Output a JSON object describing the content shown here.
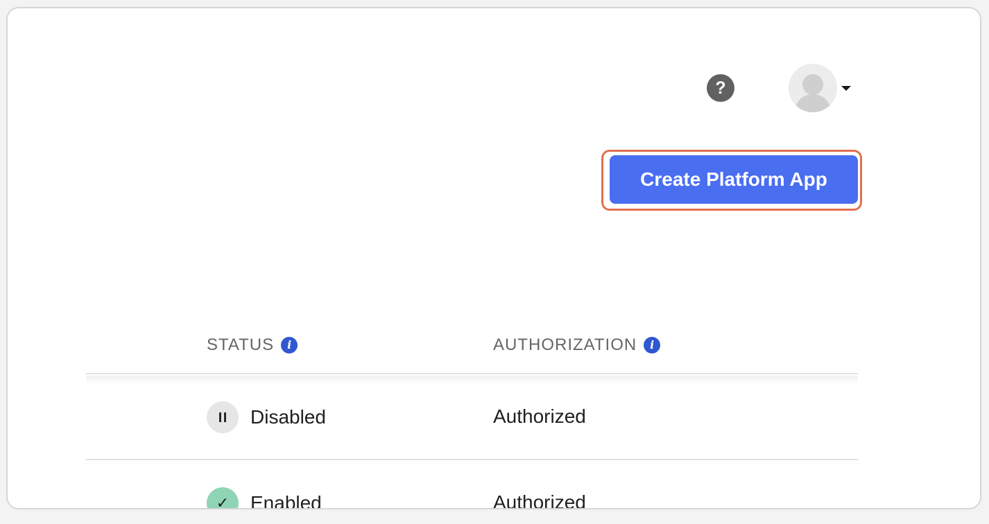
{
  "header": {
    "help_icon_glyph": "?",
    "avatar_icon": "user-avatar-icon",
    "caret_icon": "chevron-down-icon"
  },
  "toolbar": {
    "create_label": "Create Platform App",
    "create_color": "#4a6ef0",
    "highlight_color": "#e0714f"
  },
  "table": {
    "columns": [
      {
        "label": "STATUS",
        "icon": "info-icon"
      },
      {
        "label": "AUTHORIZATION",
        "icon": "info-icon"
      }
    ],
    "rows": [
      {
        "status": "Disabled",
        "status_icon": "pause-icon",
        "authorization": "Authorized"
      },
      {
        "status": "Enabled",
        "status_icon": "check-icon",
        "authorization": "Authorized"
      }
    ],
    "info_glyph": "i",
    "check_glyph": "✓"
  }
}
